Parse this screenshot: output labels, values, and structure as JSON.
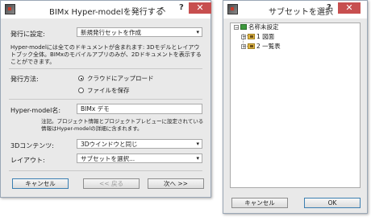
{
  "dialog1": {
    "title": "BIMx Hyper-modelを発行する",
    "help": "?",
    "close": "✕",
    "publish_settings_label": "発行に設定:",
    "publish_settings_value": "新規発行セットを作成",
    "description": "Hyper-modelには全てのドキュメントが含まれます: 3Dモデルとレイアウトブック全体。BIMxのモバイルアプリのみが、2Dドキュメントを表示することができます。",
    "method_label": "発行方法:",
    "radio_cloud": "クラウドにアップロード",
    "radio_file": "ファイルを保存",
    "name_label": "Hyper-model名:",
    "name_value": "BIMx デモ",
    "note": "注記。プロジェクト情報とプロジェクトプレビューに設定されている情報はHyper-modelの詳細に含まれます。",
    "content_label": "3Dコンテンツ:",
    "content_value": "3Dウインドウと同じ",
    "layout_label": "レイアウト:",
    "layout_value": "サブセットを選択...",
    "cancel": "キャンセル",
    "back": "<< 戻る",
    "next": "次へ >>"
  },
  "dialog2": {
    "title": "サブセットを選択",
    "help": "?",
    "close": "✕",
    "tree": [
      {
        "label": "名称未設定",
        "expander": "−"
      },
      {
        "label": "1 図面",
        "expander": "+"
      },
      {
        "label": "2 一覧表",
        "expander": "+"
      }
    ],
    "cancel": "キャンセル",
    "ok": "OK"
  }
}
